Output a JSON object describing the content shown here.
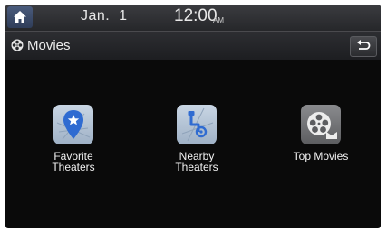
{
  "status": {
    "date": "Jan.  1",
    "time": "12:00",
    "ampm": "AM"
  },
  "header": {
    "title": "Movies"
  },
  "menu": {
    "items": [
      {
        "label_line1": "Favorite",
        "label_line2": "Theaters",
        "icon": "location-star-icon"
      },
      {
        "label_line1": "Nearby",
        "label_line2": "Theaters",
        "icon": "route-icon"
      },
      {
        "label_line1": "Top Movies",
        "label_line2": "",
        "icon": "film-reel-icon"
      }
    ]
  },
  "colors": {
    "status_bar": "#2f3033",
    "home_button": "#3d4d6c",
    "background": "#0a0a0a",
    "blue_tile": "#b3c3d6",
    "pin_blue": "#2f6bd1"
  }
}
